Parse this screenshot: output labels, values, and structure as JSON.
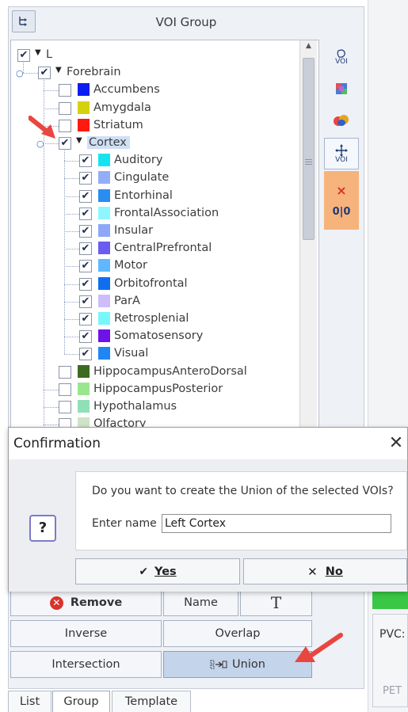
{
  "panel": {
    "title": "VOI Group",
    "header_icon": "tree-toggle-icon"
  },
  "tree": {
    "root": {
      "label": "L"
    },
    "forebrain": {
      "label": "Forebrain"
    },
    "items_top": [
      {
        "label": "Accumbens",
        "color": "#0b1df0",
        "checked": false
      },
      {
        "label": "Amygdala",
        "color": "#d6d10f",
        "checked": false
      },
      {
        "label": "Striatum",
        "color": "#ff1a0f",
        "checked": false
      }
    ],
    "cortex": {
      "label": "Cortex",
      "checked": true
    },
    "cortex_children": [
      {
        "label": "Auditory",
        "color": "#17e3f0",
        "checked": true
      },
      {
        "label": "Cingulate",
        "color": "#93aef7",
        "checked": true
      },
      {
        "label": "Entorhinal",
        "color": "#2b8cf2",
        "checked": true
      },
      {
        "label": "FrontalAssociation",
        "color": "#8ef6ff",
        "checked": true
      },
      {
        "label": "Insular",
        "color": "#8ca8f7",
        "checked": true
      },
      {
        "label": "CentralPrefrontal",
        "color": "#6a5bf2",
        "checked": true
      },
      {
        "label": "Motor",
        "color": "#5fb8ff",
        "checked": true
      },
      {
        "label": "Orbitofrontal",
        "color": "#0f6ef0",
        "checked": true
      },
      {
        "label": "ParA",
        "color": "#cdbdfb",
        "checked": true
      },
      {
        "label": "Retrosplenial",
        "color": "#77f7fb",
        "checked": true
      },
      {
        "label": "Somatosensory",
        "color": "#6e12e8",
        "checked": true
      },
      {
        "label": "Visual",
        "color": "#1f86f5",
        "checked": true
      }
    ],
    "items_bottom": [
      {
        "label": "HippocampusAnteroDorsal",
        "color": "#3b6b1f",
        "checked": false
      },
      {
        "label": "HippocampusPosterior",
        "color": "#9ae68f",
        "checked": false
      },
      {
        "label": "Hypothalamus",
        "color": "#8fe0b6",
        "checked": false
      },
      {
        "label": "Olfactory",
        "color": "#cfe3c6",
        "checked": false
      }
    ]
  },
  "toolbar": {
    "voi_label": "VOI",
    "cross_symbol": "×",
    "split_symbol": "0|0"
  },
  "buttons": {
    "remove": "Remove",
    "name": "Name",
    "text_symbol": "T",
    "inverse": "Inverse",
    "overlap": "Overlap",
    "intersection": "Intersection",
    "union": "Union"
  },
  "tabs": [
    "List",
    "Group",
    "Template"
  ],
  "side": {
    "pvc": "PVC:",
    "pet": "PET"
  },
  "dialog": {
    "title": "Confirmation",
    "close_symbol": "✕",
    "message": "Do you want to create the Union of the selected VOIs?",
    "name_label": "Enter name",
    "name_value": "Left Cortex",
    "yes_label": "Yes",
    "no_label": "No",
    "question_symbol": "?"
  },
  "colors": {
    "accent_green": "#39c745",
    "arrow_red": "#e8463f",
    "toolbar_orange": "#f6b37c"
  }
}
